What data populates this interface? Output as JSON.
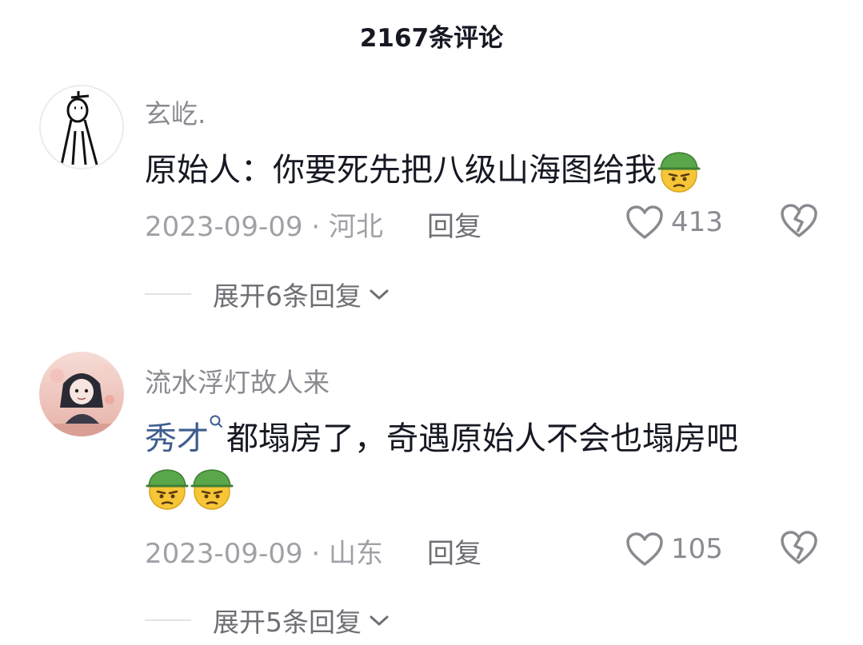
{
  "header": {
    "title": "2167条评论"
  },
  "comments": [
    {
      "username": "玄屹.",
      "text": "原始人：你要死先把八级山海图给我",
      "emoji": "thinking-soldier-emoji",
      "date": "2023-09-09",
      "separator": " · ",
      "location": "河北",
      "reply_label": "回复",
      "likes": "413",
      "expand_label": "展开6条回复"
    },
    {
      "username": "流水浮灯故人来",
      "mention": "秀才",
      "text": "都塌房了，奇遇原始人不会也塌房吧",
      "emoji": "thinking-soldier-emoji",
      "date": "2023-09-09",
      "separator": " · ",
      "location": "山东",
      "reply_label": "回复",
      "likes": "105",
      "expand_label": "展开5条回复"
    }
  ],
  "colors": {
    "text": "#161823",
    "secondary": "#8a8b91",
    "mention": "#3f5d8f",
    "helmet": "#5aa64a",
    "face": "#f6c637"
  }
}
